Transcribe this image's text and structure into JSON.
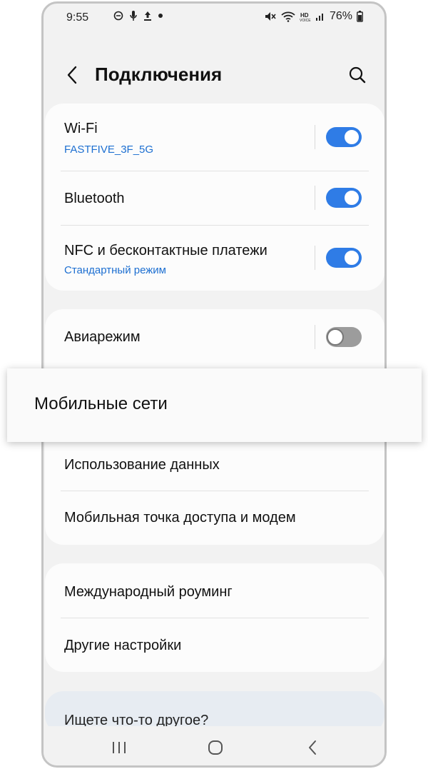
{
  "status_bar": {
    "time": "9:55",
    "battery": "76%",
    "left_icons": [
      "minus-circle-icon",
      "mic-icon",
      "upload-icon",
      "dot-icon"
    ],
    "right_icons": [
      "mute-icon",
      "wifi-icon",
      "hd-voice-icon",
      "signal-icon",
      "battery-icon"
    ]
  },
  "header": {
    "title": "Подключения"
  },
  "sections": {
    "connectivity": {
      "wifi": {
        "title": "Wi-Fi",
        "subtitle": "FASTFIVE_3F_5G",
        "enabled": true
      },
      "bluetooth": {
        "title": "Bluetooth",
        "enabled": true
      },
      "nfc": {
        "title": "NFC и бесконтактные платежи",
        "subtitle": "Стандартный режим",
        "enabled": true
      }
    },
    "network": {
      "airplane": {
        "title": "Авиарежим",
        "enabled": false
      },
      "mobile_networks": {
        "title": "Мобильные сети"
      },
      "data_usage": {
        "title": "Использование данных"
      },
      "hotspot": {
        "title": "Мобильная точка доступа и модем"
      }
    },
    "more": {
      "roaming": {
        "title": "Международный роуминг"
      },
      "other": {
        "title": "Другие настройки"
      }
    },
    "hint": {
      "title": "Ищете что-то другое?"
    }
  },
  "colors": {
    "accent": "#2f7ce6",
    "link": "#1d6fd1",
    "background": "#f2f2f2",
    "card": "#fcfcfc"
  },
  "nav_bar": {
    "icons": [
      "recents-icon",
      "home-icon",
      "back-icon"
    ]
  }
}
